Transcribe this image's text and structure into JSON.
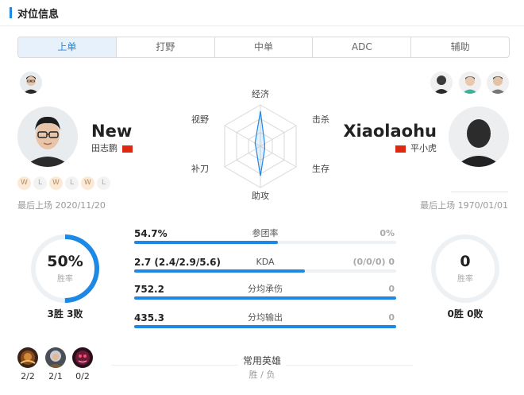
{
  "section": {
    "title": "对位信息"
  },
  "tabs": [
    "上单",
    "打野",
    "中单",
    "ADC",
    "辅助"
  ],
  "active_tab": "上单",
  "left_player": {
    "name": "New",
    "real_name": "田志鹏",
    "form": [
      "W",
      "L",
      "W",
      "L",
      "W",
      "L"
    ],
    "last_played": "最后上场 2020/11/20",
    "win_rate": "50%",
    "win_rate_value": 0.5,
    "win_rate_label": "胜率",
    "record": "3胜 3败"
  },
  "right_player": {
    "name": "Xiaolaohu",
    "real_name": "平小虎",
    "last_played": "最后上场 1970/01/01",
    "win_rate": "0",
    "win_rate_value": 0,
    "win_rate_label": "胜率",
    "record": "0胜 0败"
  },
  "radar": {
    "labels": [
      "经济",
      "击杀",
      "生存",
      "助攻",
      "补刀",
      "视野"
    ],
    "left_values": [
      0.85,
      0.12,
      0.12,
      0.72,
      0.12,
      0.15
    ],
    "right_values": [
      0,
      0,
      0,
      0,
      0,
      0
    ],
    "colors": {
      "left": "#1e88e5",
      "grid": "#d9d9d9"
    }
  },
  "stats": [
    {
      "label": "参团率",
      "left": "54.7%",
      "right": "0%",
      "fill": 0.547
    },
    {
      "label": "KDA",
      "left": "2.7 (2.4/2.9/5.6)",
      "right": "(0/0/0) 0",
      "fill": 0.65
    },
    {
      "label": "分均承伤",
      "left": "752.2",
      "right": "0",
      "fill": 1.0
    },
    {
      "label": "分均输出",
      "left": "435.3",
      "right": "0",
      "fill": 1.0
    }
  ],
  "heroes": [
    {
      "icon": "hero-icon-1",
      "record": "2/2"
    },
    {
      "icon": "hero-icon-2",
      "record": "2/1"
    },
    {
      "icon": "hero-icon-3",
      "record": "0/2"
    }
  ],
  "common_heroes": {
    "title": "常用英雄",
    "subtitle": "胜 / 负"
  },
  "colors": {
    "accent": "#1e88e5",
    "win": "#c98a4b",
    "flag": "#de2910"
  }
}
